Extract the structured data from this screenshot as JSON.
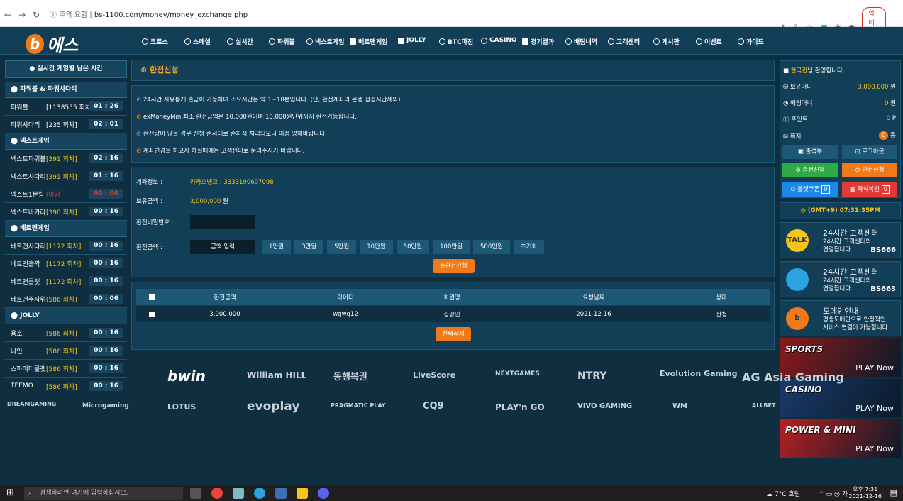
{
  "browser": {
    "security": "주의 요함",
    "url": "bs-1100.com/money/money_exchange.php",
    "update": "업데이트"
  },
  "brand": {
    "name": "에스"
  },
  "menu": [
    "크로스",
    "스페셜",
    "실시간",
    "파워볼",
    "넥스트게임",
    "베트맨게임",
    "JOLLY",
    "BTC마진",
    "CASINO",
    "경기결과",
    "배팅내역",
    "고객센터",
    "게시판",
    "이벤트",
    "가이드"
  ],
  "left": {
    "header": "실시간 게임별 남은 시간",
    "sections": [
      {
        "title": "파워볼 & 파워사다리",
        "rows": [
          {
            "name": "파워볼",
            "round": "[1138555 회차]",
            "time": "01 : 26",
            "color": "w"
          },
          {
            "name": "파워사다리",
            "round": "[235 회차]",
            "time": "02 : 01",
            "color": "w"
          }
        ]
      },
      {
        "title": "넥스트게임",
        "rows": [
          {
            "name": "넥스트파워볼",
            "round": "[391 회차]",
            "time": "02 : 16",
            "color": "y"
          },
          {
            "name": "넥스트사다리",
            "round": "[391 회차]",
            "time": "01 : 16",
            "color": "y"
          },
          {
            "name": "넥스트1분링",
            "round": "[마감]",
            "time": "00 : 00",
            "color": "r"
          },
          {
            "name": "넥스트바카라",
            "round": "[390 회차]",
            "time": "00 : 16",
            "color": "y"
          }
        ]
      },
      {
        "title": "베트맨게임",
        "rows": [
          {
            "name": "베트맨사다리",
            "round": "[1172 회차]",
            "time": "00 : 16",
            "color": "y"
          },
          {
            "name": "베트맨홀짝",
            "round": "[1172 회차]",
            "time": "00 : 16",
            "color": "y"
          },
          {
            "name": "베트맨룰렛",
            "round": "[1172 회차]",
            "time": "00 : 16",
            "color": "y"
          },
          {
            "name": "베트맨주사위",
            "round": "[586 회차]",
            "time": "00 : 06",
            "color": "y"
          }
        ]
      },
      {
        "title": "JOLLY",
        "rows": [
          {
            "name": "용호",
            "round": "[586 회차]",
            "time": "00 : 16",
            "color": "y"
          },
          {
            "name": "나인",
            "round": "[586 회차]",
            "time": "00 : 16",
            "color": "y"
          },
          {
            "name": "스파이더룰렛",
            "round": "[586 회차]",
            "time": "00 : 16",
            "color": "y"
          },
          {
            "name": "TEEMO",
            "round": "[586 회차]",
            "time": "00 : 16",
            "color": "y"
          }
        ]
      }
    ]
  },
  "main": {
    "title": "환전신청",
    "notices": [
      "24시간 자유롭게 출금이 가능하며 소요시간은 약 1~10분입니다. (단, 환전계좌의 은행 점검시간제외)",
      "exMoneyMin 최소 환전금액은 10,000원이며 10,000원단위까지 환전가능합니다.",
      "환전량이 많을 경우 신청 순서대로 순차적 처리되오니 이점 양해바랍니다.",
      "계좌변경을 하고자 하실때에는 고객센터로 문의주시기 바랍니다."
    ],
    "form": {
      "account_label": "계좌정보 :",
      "account_value": "카카오뱅크 : 3333190697098",
      "money_label": "보유금액 :",
      "money_value": "3,000,000",
      "money_unit": "원",
      "pw_label": "환전비밀번호 :",
      "amount_label": "환전금액 :",
      "amount_input": "금액 입력",
      "amount_buttons": [
        "1만원",
        "3만원",
        "5만원",
        "10만원",
        "50만원",
        "100만원",
        "500만원",
        "초기화"
      ],
      "submit": "환전신청"
    },
    "history": {
      "headers": [
        "환전금액",
        "아이디",
        "회원명",
        "요청날짜",
        "상태"
      ],
      "rows": [
        [
          "3,000,000",
          "wqwq12",
          "김강민",
          "2021-12-16",
          "신청"
        ]
      ],
      "delete": "선택삭제"
    }
  },
  "right": {
    "welcome_name": "한국관",
    "welcome_suffix": "님 환영합니다.",
    "items": [
      {
        "label": "보유머니",
        "value": "3,000,000",
        "unit": "원"
      },
      {
        "label": "배팅머니",
        "value": "0",
        "unit": "원"
      },
      {
        "label": "포인트",
        "value": "0",
        "unit": "P"
      },
      {
        "label": "쪽지",
        "value": "0",
        "unit": "통"
      }
    ],
    "btn_attend": "출석부",
    "btn_logout": "로그아웃",
    "btn_charge": "충전신청",
    "btn_exchange": "환전신청",
    "btn_roulette": "룰렛쿠폰",
    "roulette_count": "0",
    "btn_bonus": "즉석복권",
    "bonus_count": "0",
    "clock": "(GMT+9) 07:31:35PM",
    "cards": [
      {
        "title": "24시간 고객센터",
        "sub1": "24시간 고객센터와",
        "sub2": "연결됩니다.",
        "code": "BS666",
        "badge": "TALK",
        "color": "#f5c518"
      },
      {
        "title": "24시간 고객센터",
        "sub1": "24시간 고객센터와",
        "sub2": "연결됩니다.",
        "code": "BS663",
        "badge": "",
        "color": "#2aa3df"
      },
      {
        "title": "도메인안내",
        "sub1": "평생도메인으로 안정적인",
        "sub2": "서비스 연결이 가능합니다.",
        "code": "",
        "badge": "b",
        "color": "#f07a1a"
      }
    ],
    "banners": [
      {
        "title": "SPORTS",
        "play": "PLAY Now",
        "color": "#8b1a1a"
      },
      {
        "title": "CASINO",
        "play": "PLAY Now",
        "color": "#1a3a6b"
      },
      {
        "title": "POWER & MINI",
        "play": "PLAY Now",
        "color": "#b82020"
      }
    ]
  },
  "providers": [
    "bwin",
    "William HILL",
    "동행복권",
    "LiveScore",
    "NEXTGAMES",
    "NTRY",
    "Evolution Gaming",
    "AG Asia Gaming",
    "DREAMGAMING",
    "Microgaming",
    "LOTUS",
    "evoplay",
    "PRAGMATIC PLAY",
    "CQ9",
    "PLAY'n GO",
    "VIVO GAMING",
    "WM",
    "ALLBET"
  ],
  "taskbar": {
    "search": "검색하려면 여기에 입력하십시오.",
    "weather": "7°C 흐림",
    "time": "오후 7:31",
    "date": "2021-12-16",
    "lang": "가"
  }
}
